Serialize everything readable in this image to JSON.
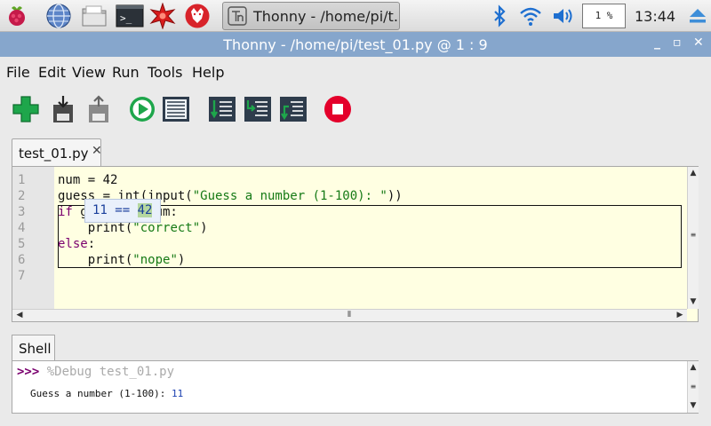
{
  "taskbar": {
    "icons": [
      "raspberry-menu-icon",
      "globe-icon",
      "folder-icon",
      "terminal-icon",
      "mathematica-icon",
      "wolfram-icon"
    ],
    "task_label": "Thonny  -  /home/pi/t…",
    "cpu": "1 %",
    "clock": "13:44",
    "tray_icons": [
      "bluetooth-icon",
      "wifi-icon",
      "volume-icon",
      "eject-icon"
    ]
  },
  "window": {
    "title": "Thonny  -  /home/pi/test_01.py  @  1 : 9",
    "controls": [
      "_",
      "▫",
      "✕"
    ]
  },
  "menu": [
    "File",
    "Edit",
    "View",
    "Run",
    "Tools",
    "Help"
  ],
  "toolbar": [
    "new-icon",
    "save-icon",
    "load-icon",
    "run-icon",
    "debug-icon",
    "step-over-icon",
    "step-into-icon",
    "step-out-icon",
    "stop-icon"
  ],
  "editor": {
    "tab_label": "test_01.py",
    "tab_close": "✕",
    "line_numbers": [
      "1",
      "2",
      "3",
      "4",
      "5",
      "6",
      "7"
    ],
    "lines": {
      "l1": "num = 42",
      "l2a": "guess = int(input(",
      "l2b": "\"Guess a number (1-100): \"",
      "l2c": "))",
      "l3a": "if",
      "l3b": " guess == num:",
      "l4a": "    print(",
      "l4b": "\"correct\"",
      "l4c": ")",
      "l5a": "else",
      "l5b": ":",
      "l6a": "    print(",
      "l6b": "\"nope\"",
      "l6c": ")"
    },
    "eval_left": "11 == ",
    "eval_right": "42"
  },
  "shell": {
    "tab_label": "Shell",
    "prompt": ">>> ",
    "command": "%Debug test_01.py",
    "output_text": "Guess a number (1-100): ",
    "output_input": "11"
  },
  "colors": {
    "title_bar": "#86a6cc",
    "editor_bg": "#ffffe2",
    "keyword": "#7a006e",
    "string": "#167a16",
    "stop_red": "#e4002b",
    "run_green": "#1ea64b"
  }
}
